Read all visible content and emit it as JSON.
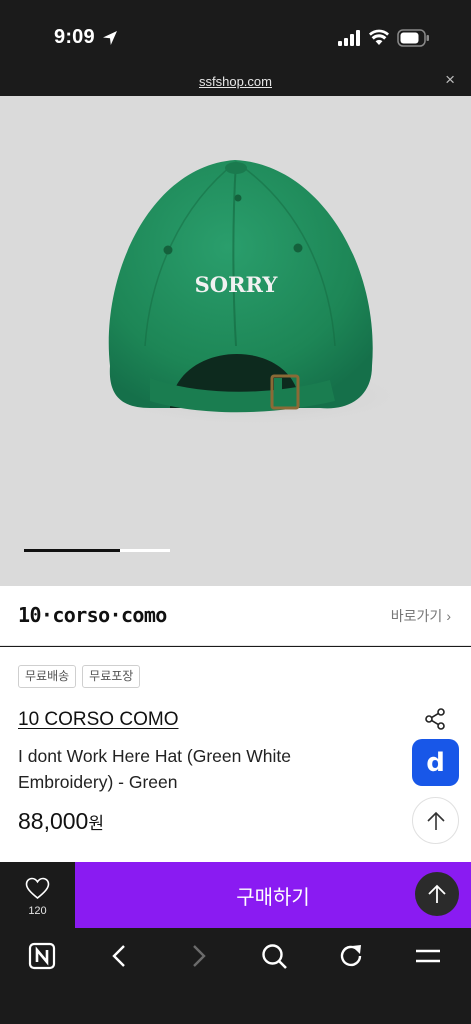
{
  "status_bar": {
    "time": "9:09"
  },
  "url_bar": {
    "domain": "ssfshop.com",
    "close_glyph": "×"
  },
  "product_image": {
    "embroidery_text": "SORRY",
    "cap_color": "#1e8a5e",
    "carousel_position": 0.66
  },
  "brand_row": {
    "logo": "10·corso·como",
    "link_label": "바로가기",
    "link_chevron": "›"
  },
  "product": {
    "tags": [
      "무료배송",
      "무료포장"
    ],
    "brand_name": "10 CORSO COMO",
    "title": "I dont Work Here Hat (Green White Embroidery) - Green",
    "price": "88,000",
    "price_unit": "원"
  },
  "side_buttons": {
    "d_label": "d"
  },
  "buy_bar": {
    "wish_count": "120",
    "buy_label": "구매하기"
  },
  "toolbar": {
    "icons": [
      "n-logo-icon",
      "back-icon",
      "forward-icon",
      "search-icon",
      "refresh-icon",
      "menu-icon"
    ]
  },
  "colors": {
    "accent_purple": "#8a1bf2",
    "accent_blue": "#1857e8",
    "dark_bg": "#1b1b1b"
  }
}
